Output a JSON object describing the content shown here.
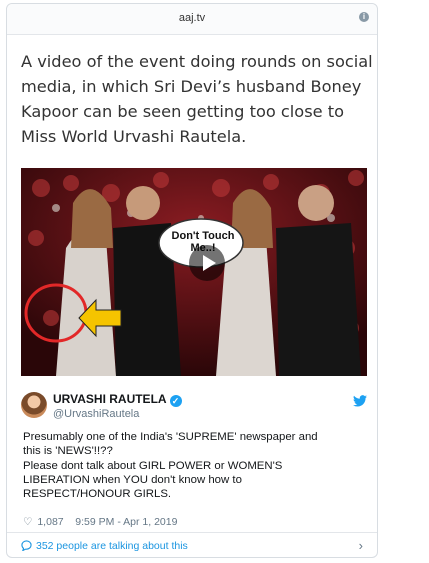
{
  "source": {
    "domain": "aaj.tv"
  },
  "article": {
    "headline": "A video of the event doing rounds on social media, in which Sri Devi’s husband Boney Kapoor can be seen getting too close to Miss World Urvashi Rautela."
  },
  "media": {
    "caption_text": "Don't Touch Me..!"
  },
  "tweet": {
    "author_name": "URVASHI RAUTELA",
    "handle": "@UrvashiRautela",
    "text": "Presumably one of the India's 'SUPREME' newspaper and this is 'NEWS'!!??\nPlease dont talk about GIRL POWER or WOMEN'S LIBERATION when YOU don't know how to RESPECT/HONOUR GIRLS.",
    "likes": "1,087",
    "timestamp": "9:59 PM - Apr 1, 2019"
  },
  "footer": {
    "talk_label": "352 people are talking about this"
  },
  "colors": {
    "link": "#1b95e0",
    "verified": "#1da1f2",
    "muted": "#657786"
  },
  "icons": [
    "info-icon",
    "play-icon",
    "verified-icon",
    "twitter-bird-icon",
    "heart-icon",
    "speech-bubble-icon",
    "chevron-right-icon"
  ]
}
